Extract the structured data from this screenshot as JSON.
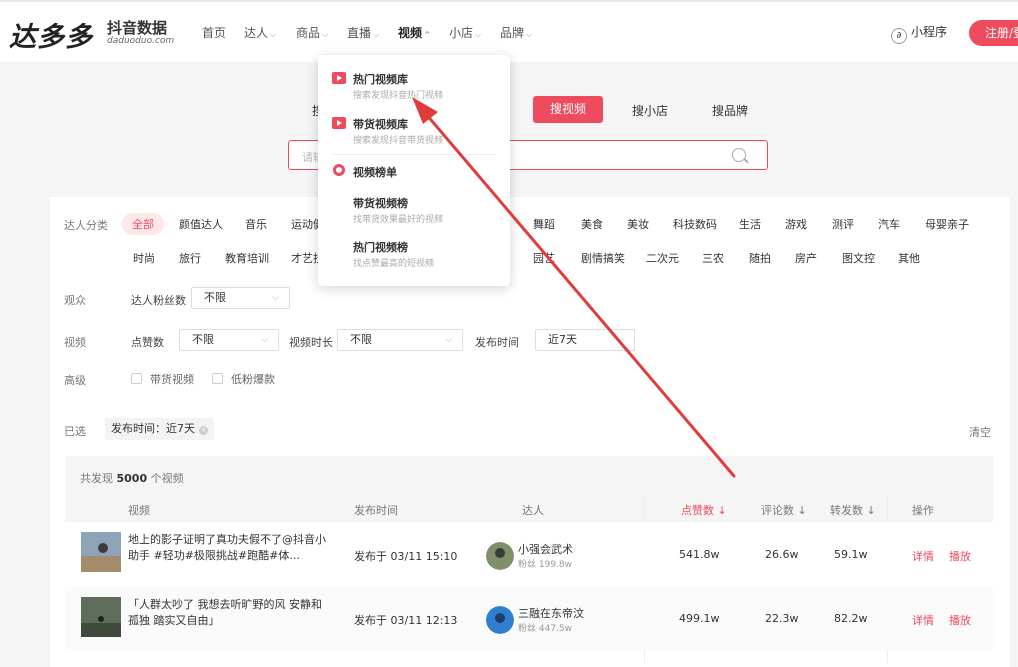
{
  "brand": {
    "logo": "达多多",
    "sub": "抖音数据",
    "domain": "daduoduo.com"
  },
  "nav": [
    {
      "label": "首页",
      "chevron": false
    },
    {
      "label": "达人",
      "chevron": true
    },
    {
      "label": "商品",
      "chevron": true
    },
    {
      "label": "直播",
      "chevron": true
    },
    {
      "label": "视频",
      "chevron": true
    },
    {
      "label": "小店",
      "chevron": true
    },
    {
      "label": "品牌",
      "chevron": true
    }
  ],
  "header": {
    "mini_program": "小程序",
    "register": "注册/登录"
  },
  "search": {
    "tabs": [
      "搜",
      "搜视频",
      "搜小店",
      "搜品牌"
    ],
    "placeholder": "请输"
  },
  "dropdown": {
    "items": [
      {
        "title": "热门视频库",
        "desc": "搜索发现抖音热门视频"
      },
      {
        "title": "带货视频库",
        "desc": "搜索发现抖音带货视频"
      },
      {
        "title": "视频榜单",
        "desc": ""
      },
      {
        "title": "带货视频榜",
        "desc": "找带货效果最好的视频"
      },
      {
        "title": "热门视频榜",
        "desc": "找点赞最高的短视频"
      }
    ]
  },
  "filters": {
    "category_label": "达人分类",
    "categories_row1": [
      "全部",
      "颜值达人",
      "音乐",
      "运动健",
      "舞蹈",
      "美食",
      "美妆",
      "科技数码",
      "生活",
      "游戏",
      "测评",
      "汽车",
      "母婴亲子"
    ],
    "categories_row2": [
      "时尚",
      "旅行",
      "教育培训",
      "才艺技",
      "园艺",
      "剧情搞笑",
      "二次元",
      "三农",
      "随拍",
      "房产",
      "图文控",
      "其他"
    ],
    "audience_label": "观众",
    "fans_label": "达人粉丝数",
    "fans_value": "不限",
    "video_label": "视频",
    "likes_label": "点赞数",
    "likes_value": "不限",
    "duration_label": "视频时长",
    "duration_value": "不限",
    "publish_label": "发布时间",
    "publish_value": "近7天",
    "advanced_label": "高级",
    "checkbox1": "带货视频",
    "checkbox2": "低粉爆款",
    "selected_label": "已选",
    "selected_tag": "发布时间：近7天",
    "clear": "清空"
  },
  "results": {
    "count_prefix": "共发现",
    "count": "5000",
    "count_suffix": "个视频",
    "columns": [
      "视频",
      "发布时间",
      "达人",
      "点赞数",
      "评论数",
      "转发数",
      "操作"
    ],
    "rows": [
      {
        "title": "地上的影子证明了真功夫假不了@抖音小助手 #轻功#极限挑战#跑酷#体...",
        "time": "发布于 03/11 15:10",
        "author": "小强会武术",
        "fans": "粉丝 199.8w",
        "likes": "541.8w",
        "comments": "26.6w",
        "shares": "59.1w",
        "detail": "详情",
        "play": "播放"
      },
      {
        "title": "「人群太吵了 我想去听旷野的风 安静和孤独 踏实又自由」",
        "time": "发布于 03/11 12:13",
        "author": "三融在东帝汶",
        "fans": "粉丝 447.5w",
        "likes": "499.1w",
        "comments": "22.3w",
        "shares": "82.2w",
        "detail": "详情",
        "play": "播放"
      }
    ]
  },
  "colors": {
    "accent": "#ef4b5e",
    "arrow": "#e03c3c"
  }
}
